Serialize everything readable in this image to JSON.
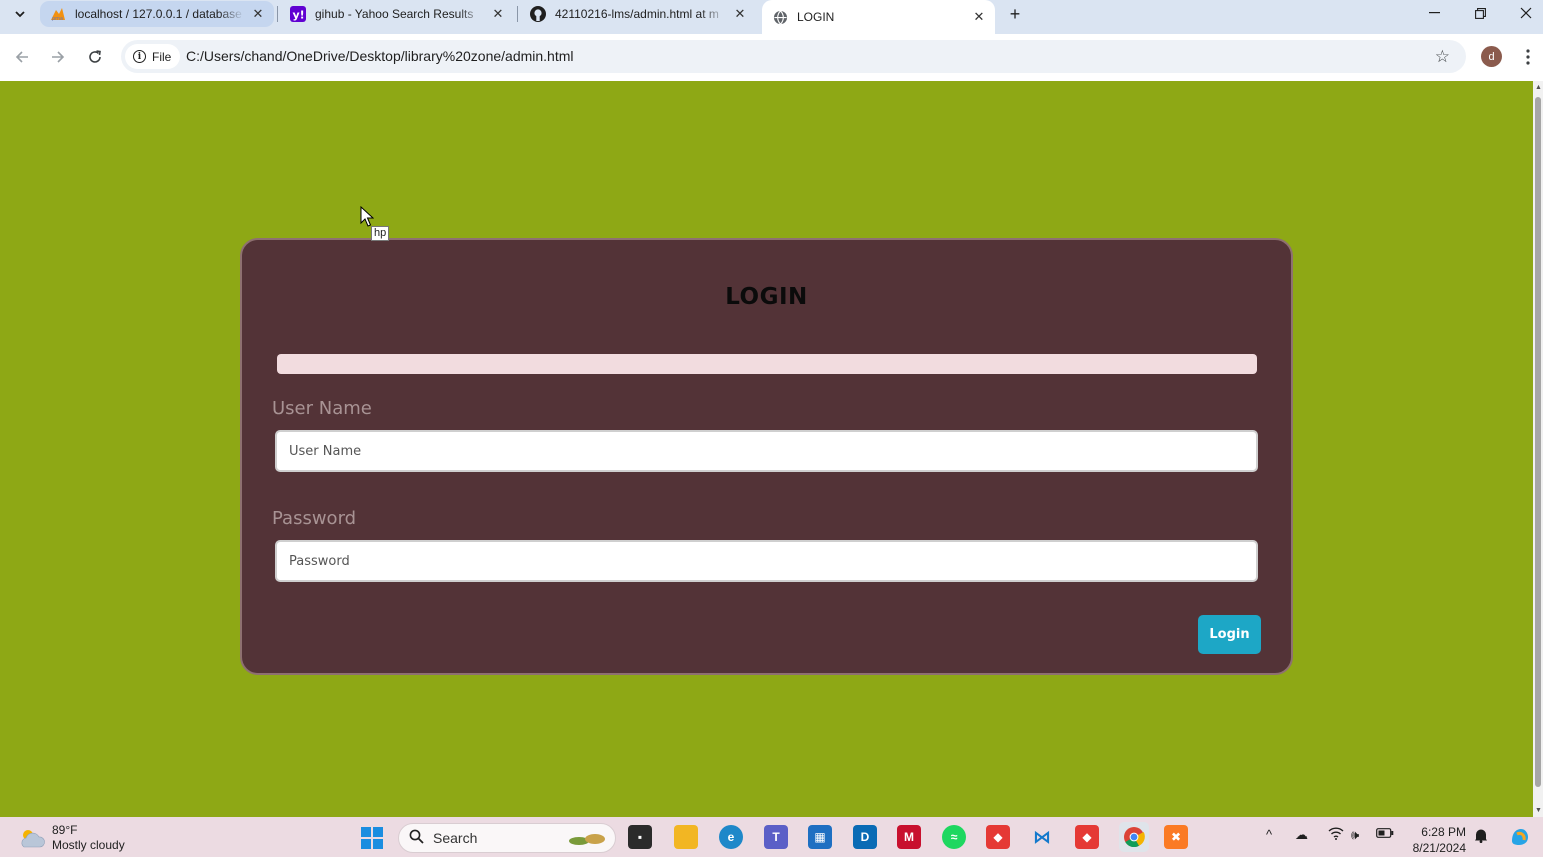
{
  "browser": {
    "tabs": [
      {
        "title": "localhost / 127.0.0.1 / database",
        "favicon": "phpmyadmin-icon"
      },
      {
        "title": "gihub - Yahoo Search Results",
        "favicon": "yahoo-icon"
      },
      {
        "title": "42110216-lms/admin.html at m",
        "favicon": "github-icon"
      },
      {
        "title": "LOGIN",
        "favicon": "globe-icon",
        "active": true
      }
    ],
    "new_tab_label": "+",
    "address": {
      "chip_label": "File",
      "url": "C:/Users/chand/OneDrive/Desktop/library%20zone/admin.html"
    },
    "profile_initial": "d"
  },
  "page": {
    "background_color": "#8ea815",
    "card_color": "#533337",
    "title": "LOGIN",
    "username": {
      "label": "User Name",
      "placeholder": "User Name",
      "value": ""
    },
    "password": {
      "label": "Password",
      "placeholder": "Password",
      "value": ""
    },
    "login_button": "Login",
    "button_color": "#1da7c6",
    "tooltip": "hp"
  },
  "taskbar": {
    "weather": {
      "temp": "89°F",
      "condition": "Mostly cloudy"
    },
    "search_label": "Search",
    "clock": {
      "time": "6:28 PM",
      "date": "8/21/2024"
    }
  }
}
